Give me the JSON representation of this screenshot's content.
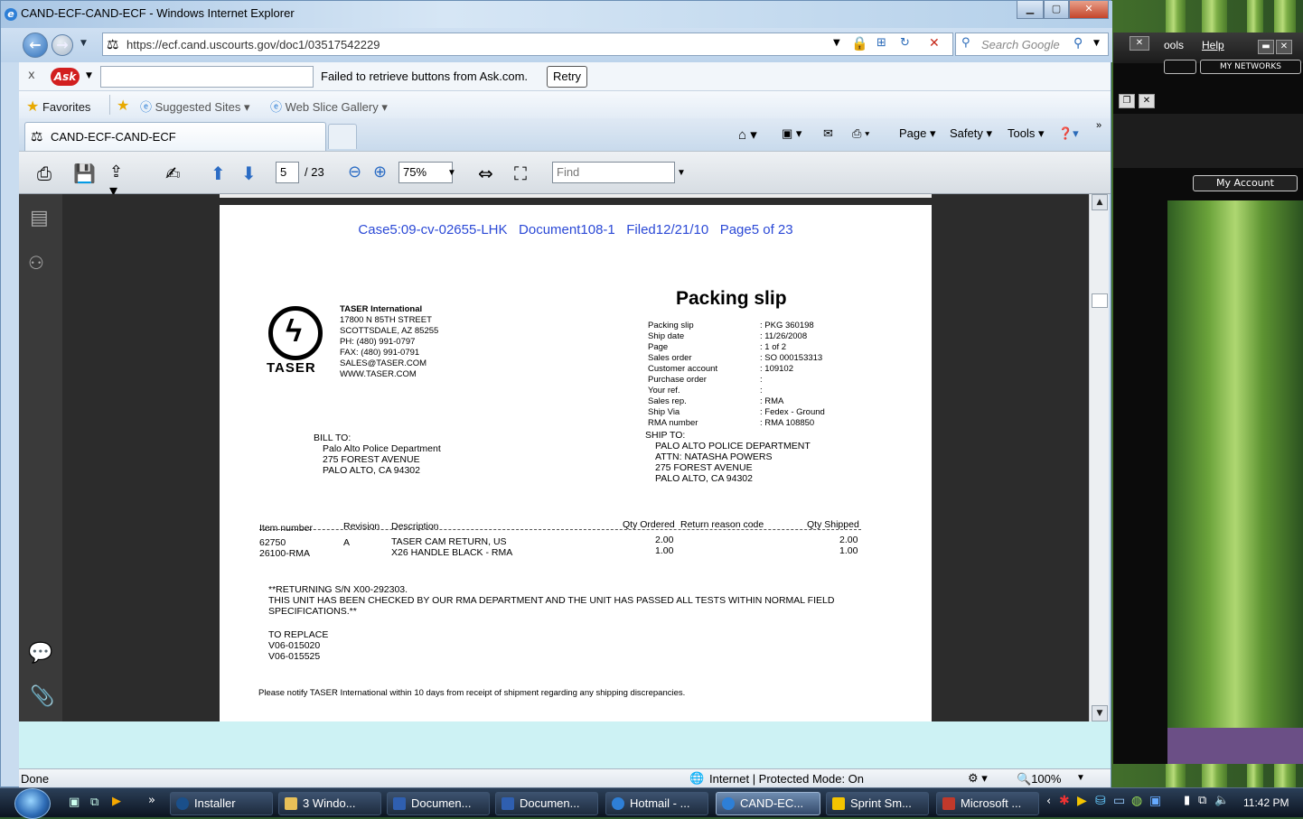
{
  "window": {
    "title": "CAND-ECF-CAND-ECF - Windows Internet Explorer",
    "url": "https://ecf.cand.uscourts.gov/doc1/03517542229",
    "search_placeholder": "Search Google"
  },
  "ask_toolbar": {
    "close": "x",
    "logo": "Ask",
    "message": "Failed to retrieve buttons from Ask.com.",
    "retry": "Retry"
  },
  "favorites_bar": {
    "favorites": "Favorites",
    "suggested_sites": "Suggested Sites",
    "web_slice_gallery": "Web Slice Gallery"
  },
  "tab": {
    "label": "CAND-ECF-CAND-ECF"
  },
  "command_bar": {
    "page": "Page",
    "safety": "Safety",
    "tools": "Tools"
  },
  "pdf_toolbar": {
    "current_page": "5",
    "total_pages": "/ 23",
    "zoom": "75%",
    "find_placeholder": "Find"
  },
  "document": {
    "header": {
      "case": "Case5:09-cv-02655-LHK",
      "document": "Document108-1",
      "filed": "Filed12/21/10",
      "page": "Page5 of 23"
    },
    "logo_text": "TASER",
    "company": {
      "name": "TASER International",
      "street": "17800 N 85TH STREET",
      "city": "SCOTTSDALE, AZ 85255",
      "phone": "PH: (480) 991-0797",
      "fax": "FAX: (480) 991-0791",
      "email": "SALES@TASER.COM",
      "web": "WWW.TASER.COM"
    },
    "title": "Packing slip",
    "details": [
      {
        "label": "Packing slip",
        "value": "PKG 360198"
      },
      {
        "label": "Ship date",
        "value": "11/26/2008"
      },
      {
        "label": "Page",
        "value": "1    of  2"
      },
      {
        "label": "Sales order",
        "value": "SO 000153313"
      },
      {
        "label": "Customer account",
        "value": "109102"
      },
      {
        "label": "Purchase order",
        "value": ""
      },
      {
        "label": "Your ref.",
        "value": ""
      },
      {
        "label": "Sales rep.",
        "value": "RMA"
      },
      {
        "label": "Ship Via",
        "value": "Fedex - Ground"
      },
      {
        "label": "RMA number",
        "value": "RMA 108850"
      }
    ],
    "bill_to": {
      "label": "BILL TO:",
      "lines": [
        "Palo Alto Police Department",
        "275 FOREST AVENUE",
        "PALO ALTO, CA  94302"
      ]
    },
    "ship_to": {
      "label": "SHIP TO:",
      "lines": [
        "PALO ALTO POLICE DEPARTMENT",
        "ATTN: NATASHA POWERS",
        "275 FOREST AVENUE",
        "PALO ALTO, CA  94302"
      ]
    },
    "table": {
      "headers": {
        "item": "Item number",
        "revision": "Revision",
        "description": "Description",
        "qty_ordered": "Qty Ordered",
        "return_reason": "Return reason code",
        "qty_shipped": "Qty Shipped"
      },
      "rows": [
        {
          "item": "62750",
          "revision": "A",
          "description": "TASER CAM RETURN, US",
          "qty_ordered": "2.00",
          "qty_shipped": "2.00"
        },
        {
          "item": "26100-RMA",
          "revision": "",
          "description": "X26 HANDLE BLACK - RMA",
          "qty_ordered": "1.00",
          "qty_shipped": "1.00"
        }
      ]
    },
    "notes": [
      "**RETURNING S/N X00-292303.",
      "THIS UNIT HAS BEEN CHECKED BY OUR RMA DEPARTMENT AND THE UNIT HAS PASSED ALL TESTS WITHIN NORMAL FIELD",
      "SPECIFICATIONS.**"
    ],
    "replace": [
      "TO REPLACE",
      "V06-015020",
      "V06-015525"
    ],
    "footer_note": "Please notify TASER International within 10 days from receipt of shipment regarding any shipping discrepancies."
  },
  "status_bar": {
    "left": "Done",
    "zone": "Internet | Protected Mode: On",
    "zoom": "100%"
  },
  "background_window": {
    "tools": "ools",
    "help": "Help",
    "networks": "MY NETWORKS",
    "account": "My Account"
  },
  "taskbar": {
    "tasks": [
      {
        "label": "Installer"
      },
      {
        "label": "3 Windo..."
      },
      {
        "label": "Documen..."
      },
      {
        "label": "Documen..."
      },
      {
        "label": "Hotmail - ..."
      },
      {
        "label": "CAND-EC..."
      },
      {
        "label": "Sprint Sm..."
      },
      {
        "label": "Microsoft ..."
      }
    ],
    "clock": "11:42 PM"
  }
}
